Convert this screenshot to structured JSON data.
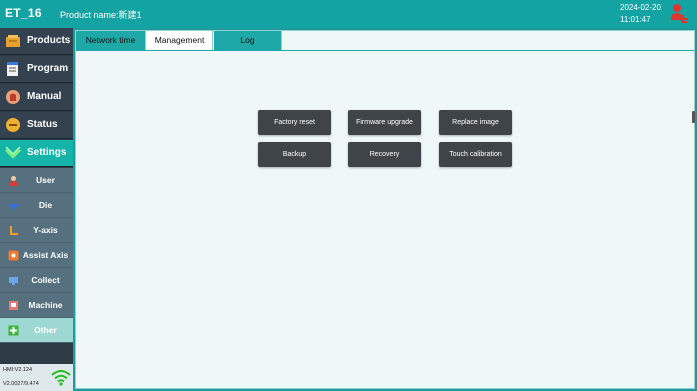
{
  "header": {
    "app_title": "ET_16",
    "product_name": "Product name:新建1",
    "date": "2024-02-20",
    "time": "11:01:47",
    "user_icon": "user-key-icon"
  },
  "sidebar": {
    "main_items": [
      {
        "label": "Products",
        "icon": "products-icon"
      },
      {
        "label": "Program",
        "icon": "program-icon"
      },
      {
        "label": "Manual",
        "icon": "manual-icon"
      },
      {
        "label": "Status",
        "icon": "status-icon"
      },
      {
        "label": "Settings",
        "icon": "settings-icon"
      }
    ],
    "sub_items": [
      {
        "label": "User",
        "icon": "user-icon"
      },
      {
        "label": "Die",
        "icon": "die-icon"
      },
      {
        "label": "Y-axis",
        "icon": "y-axis-icon"
      },
      {
        "label": "Assist Axis",
        "icon": "assist-axis-icon"
      },
      {
        "label": "Collect",
        "icon": "collect-icon"
      },
      {
        "label": "Machine",
        "icon": "machine-icon"
      },
      {
        "label": "Other",
        "icon": "other-icon"
      }
    ],
    "active_main": "Settings",
    "active_sub": "Other",
    "footer": {
      "hmi_version": "HMI:V2.124",
      "fw_version": "V2.0027/9.474"
    }
  },
  "tabs": [
    "Network time",
    "Management",
    "Log"
  ],
  "active_tab": "Management",
  "management": {
    "buttons": [
      "Factory reset",
      "Firmware upgrade",
      "Replace image",
      "Backup",
      "Recovery",
      "Touch calibration"
    ]
  },
  "colors": {
    "accent": "#14a3a3",
    "sidebar_bg": "#33424e",
    "active_item": "#14b5a8",
    "button_bg": "#3f4448"
  }
}
